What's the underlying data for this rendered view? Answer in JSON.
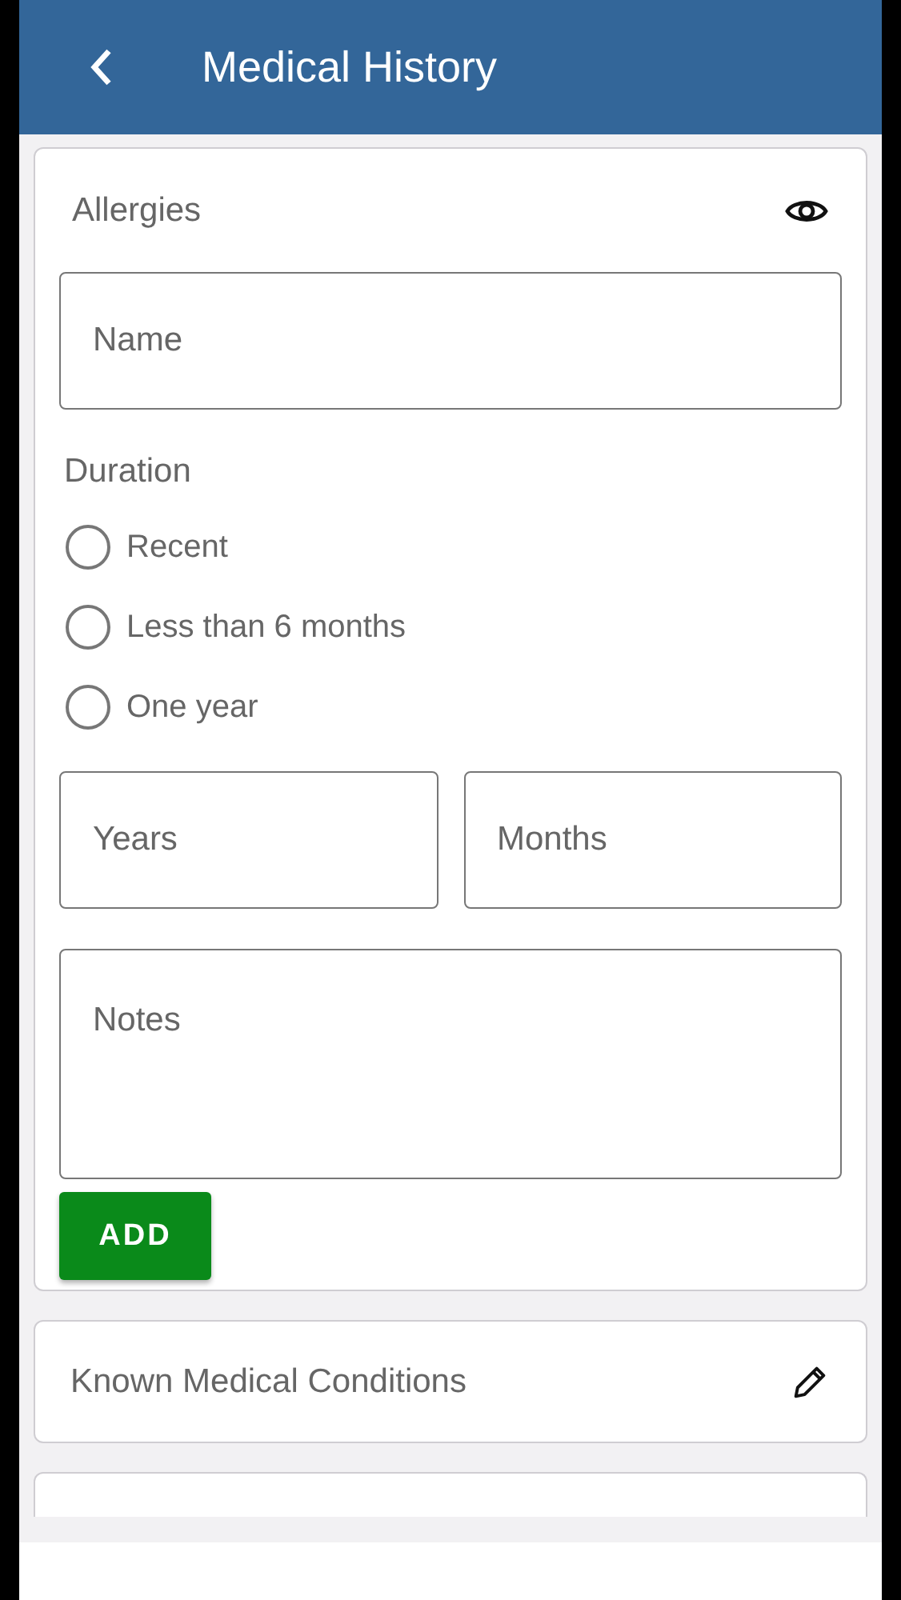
{
  "header": {
    "title": "Medical History"
  },
  "allergies": {
    "title": "Allergies",
    "name": {
      "placeholder": "Name"
    },
    "duration_label": "Duration",
    "durations": [
      {
        "label": "Recent",
        "selected": false
      },
      {
        "label": "Less than 6 months",
        "selected": false
      },
      {
        "label": "One year",
        "selected": false
      }
    ],
    "years": {
      "placeholder": "Years"
    },
    "months": {
      "placeholder": "Months"
    },
    "notes": {
      "placeholder": "Notes"
    },
    "add_button": "ADD"
  },
  "sections": [
    {
      "title": "Known Medical Conditions"
    }
  ]
}
